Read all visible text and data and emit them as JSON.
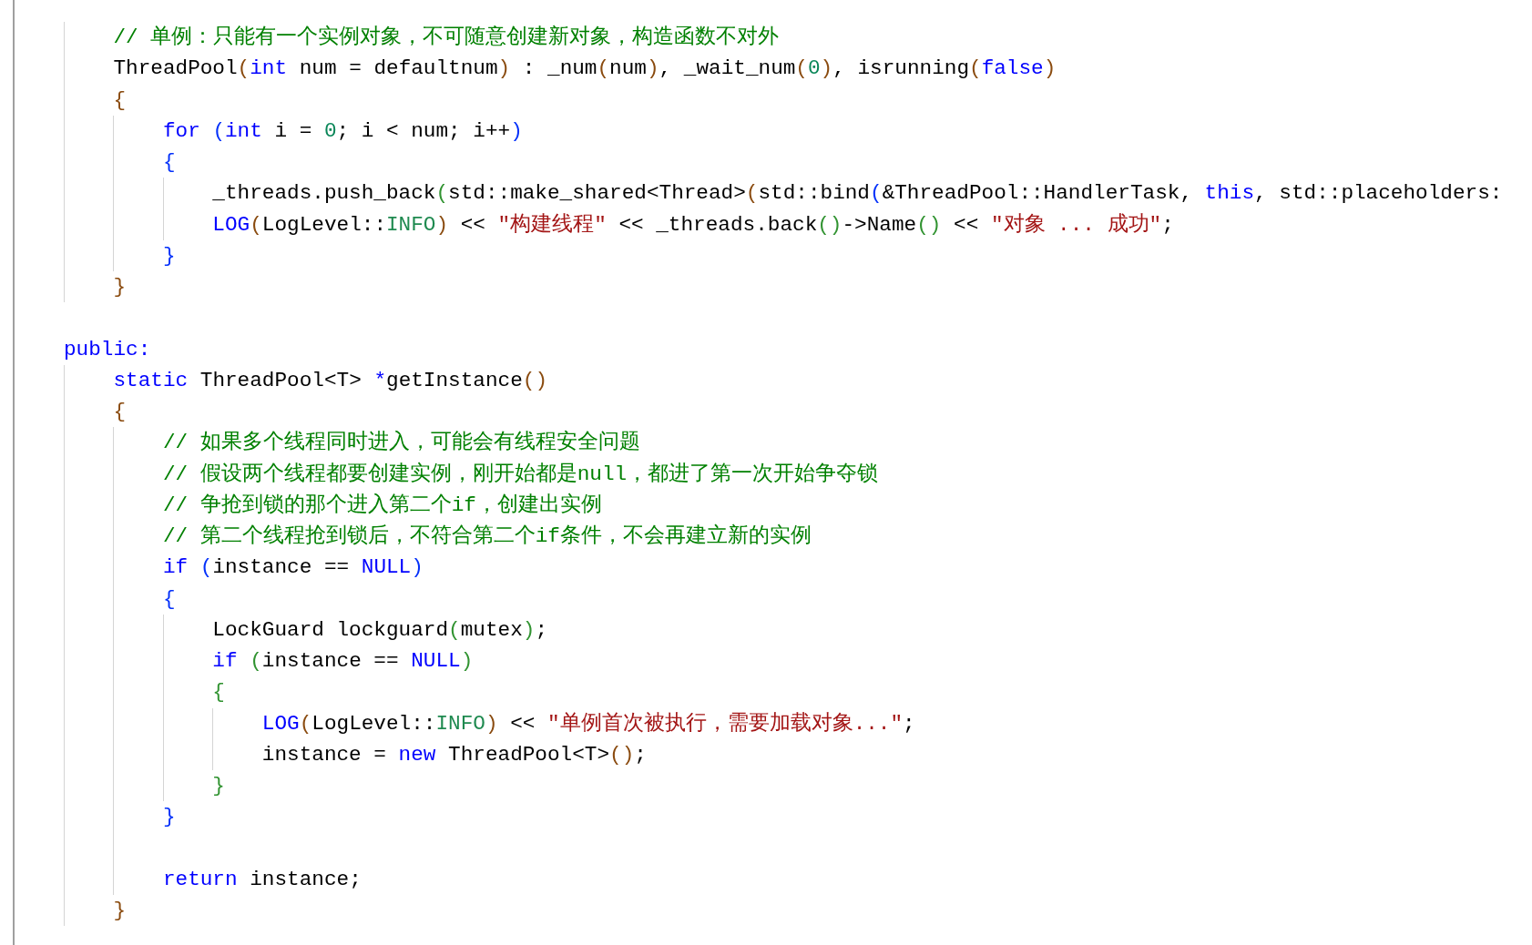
{
  "editor": {
    "lines": [
      {
        "kind": "code",
        "tokens": [
          {
            "kind": "comment",
            "text": "    // 单例：只能有一个实例对象，不可随意创建新对象，构造函数不对外"
          }
        ]
      },
      {
        "kind": "code",
        "tokens": [
          {
            "kind": "plain",
            "text": "    ThreadPool"
          },
          {
            "kind": "bracket1",
            "text": "("
          },
          {
            "kind": "keyword",
            "text": "int"
          },
          {
            "kind": "plain",
            "text": " num = defaultnum"
          },
          {
            "kind": "bracket1",
            "text": ")"
          },
          {
            "kind": "plain",
            "text": " : _num"
          },
          {
            "kind": "bracket1",
            "text": "("
          },
          {
            "kind": "plain",
            "text": "num"
          },
          {
            "kind": "bracket1",
            "text": ")"
          },
          {
            "kind": "plain",
            "text": ", _wait_num"
          },
          {
            "kind": "bracket1",
            "text": "("
          },
          {
            "kind": "number",
            "text": "0"
          },
          {
            "kind": "bracket1",
            "text": ")"
          },
          {
            "kind": "plain",
            "text": ", isrunning"
          },
          {
            "kind": "bracket1",
            "text": "("
          },
          {
            "kind": "keyword",
            "text": "false"
          },
          {
            "kind": "bracket1",
            "text": ")"
          }
        ]
      },
      {
        "kind": "code",
        "tokens": [
          {
            "kind": "bracket1",
            "text": "    {"
          }
        ]
      },
      {
        "kind": "code",
        "tokens": [
          {
            "kind": "keyword",
            "text": "        for"
          },
          {
            "kind": "bracket3",
            "text": " ("
          },
          {
            "kind": "keyword",
            "text": "int"
          },
          {
            "kind": "plain",
            "text": " i = "
          },
          {
            "kind": "number",
            "text": "0"
          },
          {
            "kind": "plain",
            "text": "; i < num; i++"
          },
          {
            "kind": "bracket3",
            "text": ")"
          }
        ]
      },
      {
        "kind": "code",
        "tokens": [
          {
            "kind": "bracket3",
            "text": "        {"
          }
        ]
      },
      {
        "kind": "code",
        "tokens": [
          {
            "kind": "plain",
            "text": "            _threads.push_back"
          },
          {
            "kind": "bracket2",
            "text": "("
          },
          {
            "kind": "plain",
            "text": "std::make_shared<Thread>"
          },
          {
            "kind": "bracket1",
            "text": "("
          },
          {
            "kind": "plain",
            "text": "std::bind"
          },
          {
            "kind": "bracket3",
            "text": "("
          },
          {
            "kind": "plain",
            "text": "&ThreadPool::HandlerTask, "
          },
          {
            "kind": "keyword",
            "text": "this"
          },
          {
            "kind": "plain",
            "text": ", std::placeholders:"
          }
        ]
      },
      {
        "kind": "code",
        "tokens": [
          {
            "kind": "macro",
            "text": "            LOG"
          },
          {
            "kind": "bracket1",
            "text": "("
          },
          {
            "kind": "plain",
            "text": "LogLevel::"
          },
          {
            "kind": "enum",
            "text": "INFO"
          },
          {
            "kind": "bracket1",
            "text": ")"
          },
          {
            "kind": "plain",
            "text": " << "
          },
          {
            "kind": "string",
            "text": "\"构建线程\""
          },
          {
            "kind": "plain",
            "text": " << _threads.back"
          },
          {
            "kind": "bracket2",
            "text": "()"
          },
          {
            "kind": "plain",
            "text": "->Name"
          },
          {
            "kind": "bracket2",
            "text": "()"
          },
          {
            "kind": "plain",
            "text": " << "
          },
          {
            "kind": "string",
            "text": "\"对象 ... 成功\""
          },
          {
            "kind": "plain",
            "text": ";"
          }
        ]
      },
      {
        "kind": "code",
        "tokens": [
          {
            "kind": "bracket3",
            "text": "        }"
          }
        ]
      },
      {
        "kind": "code",
        "tokens": [
          {
            "kind": "bracket1",
            "text": "    }"
          }
        ]
      },
      {
        "kind": "blank"
      },
      {
        "kind": "code",
        "tokens": [
          {
            "kind": "keyword",
            "text": "public:"
          }
        ]
      },
      {
        "kind": "code",
        "tokens": [
          {
            "kind": "keyword",
            "text": "    static"
          },
          {
            "kind": "plain",
            "text": " ThreadPool<T> "
          },
          {
            "kind": "keyword",
            "text": "*"
          },
          {
            "kind": "plain",
            "text": "getInstance"
          },
          {
            "kind": "bracket1",
            "text": "()"
          }
        ]
      },
      {
        "kind": "code",
        "tokens": [
          {
            "kind": "bracket1",
            "text": "    {"
          }
        ]
      },
      {
        "kind": "code",
        "tokens": [
          {
            "kind": "comment",
            "text": "        // 如果多个线程同时进入，可能会有线程安全问题"
          }
        ]
      },
      {
        "kind": "code",
        "tokens": [
          {
            "kind": "comment",
            "text": "        // 假设两个线程都要创建实例，刚开始都是null，都进了第一次开始争夺锁"
          }
        ]
      },
      {
        "kind": "code",
        "tokens": [
          {
            "kind": "comment",
            "text": "        // 争抢到锁的那个进入第二个if，创建出实例"
          }
        ]
      },
      {
        "kind": "code",
        "tokens": [
          {
            "kind": "comment",
            "text": "        // 第二个线程抢到锁后，不符合第二个if条件，不会再建立新的实例"
          }
        ]
      },
      {
        "kind": "code",
        "tokens": [
          {
            "kind": "keyword",
            "text": "        if"
          },
          {
            "kind": "bracket3",
            "text": " ("
          },
          {
            "kind": "plain",
            "text": "instance == "
          },
          {
            "kind": "keyword",
            "text": "NULL"
          },
          {
            "kind": "bracket3",
            "text": ")"
          }
        ]
      },
      {
        "kind": "code",
        "tokens": [
          {
            "kind": "bracket3",
            "text": "        {"
          }
        ]
      },
      {
        "kind": "code",
        "tokens": [
          {
            "kind": "plain",
            "text": "            LockGuard lockguard"
          },
          {
            "kind": "bracket2",
            "text": "("
          },
          {
            "kind": "plain",
            "text": "mutex"
          },
          {
            "kind": "bracket2",
            "text": ")"
          },
          {
            "kind": "plain",
            "text": ";"
          }
        ]
      },
      {
        "kind": "code",
        "tokens": [
          {
            "kind": "keyword",
            "text": "            if"
          },
          {
            "kind": "bracket2",
            "text": " ("
          },
          {
            "kind": "plain",
            "text": "instance == "
          },
          {
            "kind": "keyword",
            "text": "NULL"
          },
          {
            "kind": "bracket2",
            "text": ")"
          }
        ]
      },
      {
        "kind": "code",
        "tokens": [
          {
            "kind": "bracket2",
            "text": "            {"
          }
        ]
      },
      {
        "kind": "code",
        "tokens": [
          {
            "kind": "macro",
            "text": "                LOG"
          },
          {
            "kind": "bracket1",
            "text": "("
          },
          {
            "kind": "plain",
            "text": "LogLevel::"
          },
          {
            "kind": "enum",
            "text": "INFO"
          },
          {
            "kind": "bracket1",
            "text": ")"
          },
          {
            "kind": "plain",
            "text": " << "
          },
          {
            "kind": "string",
            "text": "\"单例首次被执行，需要加载对象...\""
          },
          {
            "kind": "plain",
            "text": ";"
          }
        ]
      },
      {
        "kind": "code",
        "tokens": [
          {
            "kind": "plain",
            "text": "                instance = "
          },
          {
            "kind": "keyword",
            "text": "new"
          },
          {
            "kind": "plain",
            "text": " ThreadPool<T>"
          },
          {
            "kind": "bracket1",
            "text": "()"
          },
          {
            "kind": "plain",
            "text": ";"
          }
        ]
      },
      {
        "kind": "code",
        "tokens": [
          {
            "kind": "bracket2",
            "text": "            }"
          }
        ]
      },
      {
        "kind": "code",
        "tokens": [
          {
            "kind": "bracket3",
            "text": "        }"
          }
        ]
      },
      {
        "kind": "blank"
      },
      {
        "kind": "code",
        "tokens": [
          {
            "kind": "keyword",
            "text": "        return"
          },
          {
            "kind": "plain",
            "text": " instance;"
          }
        ]
      },
      {
        "kind": "code",
        "tokens": [
          {
            "kind": "bracket1",
            "text": "    }"
          }
        ]
      }
    ]
  }
}
